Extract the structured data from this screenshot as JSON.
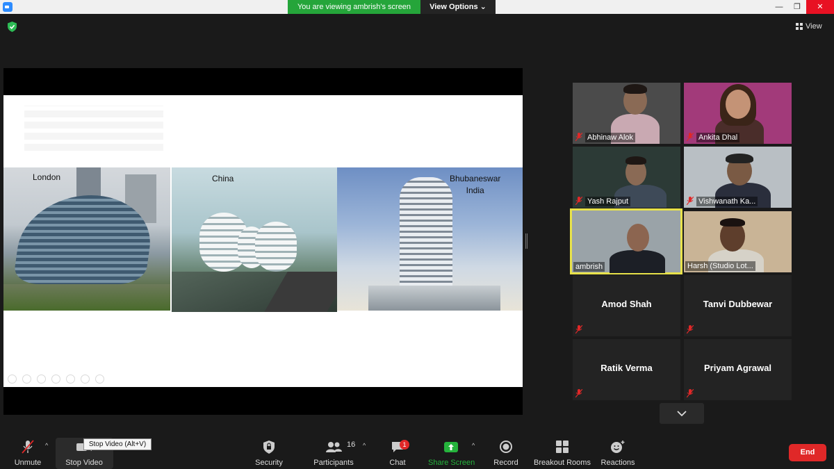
{
  "titlebar": {
    "banner": "You are viewing ambrish's screen",
    "view_options": "View Options",
    "min_glyph": "—",
    "max_glyph": "❐",
    "close_glyph": "✕"
  },
  "topbar": {
    "view_label": "View"
  },
  "slide": {
    "photos": [
      {
        "label": "London"
      },
      {
        "label": "China"
      },
      {
        "label_line1": "Bhubaneswar",
        "label_line2": "India"
      }
    ]
  },
  "gallery": {
    "video_tiles": [
      {
        "name": "Abhinaw Alok",
        "muted": true
      },
      {
        "name": "Ankita Dhal",
        "muted": true
      },
      {
        "name": "Yash Rajput",
        "muted": true
      },
      {
        "name": "Vishwanath Ka...",
        "muted": true
      },
      {
        "name": "ambrish",
        "muted": false,
        "active_speaker": true
      },
      {
        "name": "Harsh (Studio Lot...",
        "muted": false
      }
    ],
    "name_tiles": [
      {
        "name": "Amod Shah",
        "muted": true
      },
      {
        "name": "Tanvi Dubbewar",
        "muted": true
      },
      {
        "name": "Ratik Verma",
        "muted": true
      },
      {
        "name": "Priyam Agrawal",
        "muted": true
      }
    ]
  },
  "toolbar": {
    "unmute": "Unmute",
    "stop_video": "Stop Video",
    "stop_video_tooltip": "Stop Video (Alt+V)",
    "security": "Security",
    "participants": "Participants",
    "participants_count": "16",
    "chat": "Chat",
    "chat_badge": "1",
    "share_screen": "Share Screen",
    "record": "Record",
    "breakout_rooms": "Breakout Rooms",
    "reactions": "Reactions",
    "end": "End"
  },
  "colors": {
    "banner_green": "#25a53a",
    "share_green": "#25b33c",
    "end_red": "#e02828",
    "active_speaker": "#e8e24a",
    "mute_red": "#e02828"
  }
}
